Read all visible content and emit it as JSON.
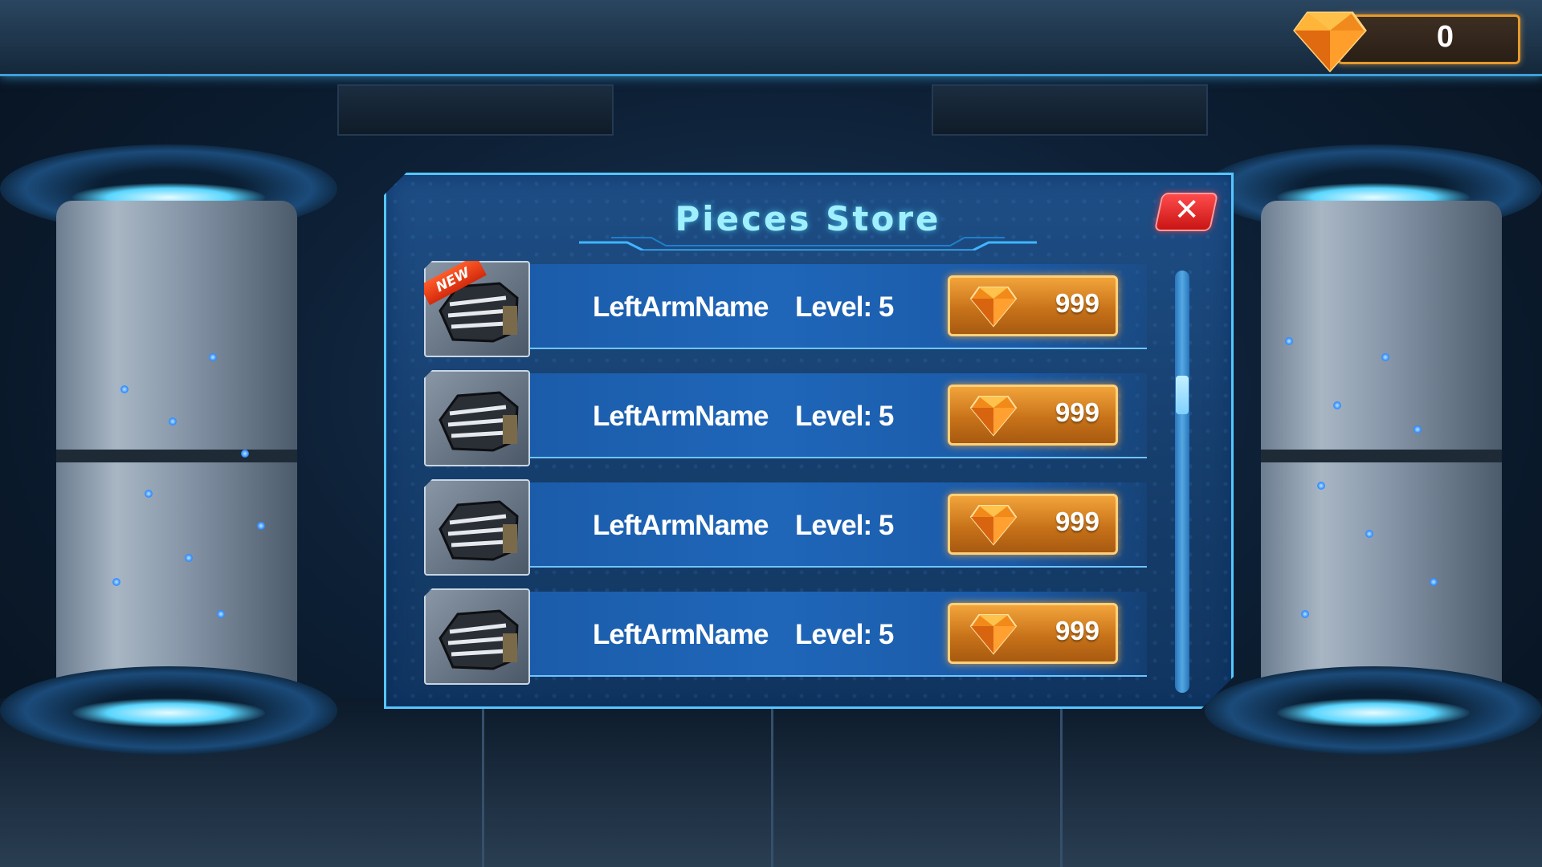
{
  "hud": {
    "gem_count": "0",
    "gem_icon": "diamond-icon"
  },
  "store": {
    "title": "Pieces Store",
    "close_label": "✕",
    "items": [
      {
        "name": "LeftArmName",
        "level": "Level: 5",
        "price": "999",
        "badge": "NEW",
        "icon": "arm-weapon-icon"
      },
      {
        "name": "LeftArmName",
        "level": "Level: 5",
        "price": "999",
        "badge": "",
        "icon": "arm-weapon-icon"
      },
      {
        "name": "LeftArmName",
        "level": "Level: 5",
        "price": "999",
        "badge": "",
        "icon": "arm-weapon-icon"
      },
      {
        "name": "LeftArmName",
        "level": "Level: 5",
        "price": "999",
        "badge": "",
        "icon": "arm-weapon-icon"
      }
    ]
  },
  "colors": {
    "panel": "#1e4e86",
    "accent": "#56c6ff",
    "price_button": "#e08a24",
    "close_button": "#e02020",
    "title_text": "#9fefff"
  }
}
